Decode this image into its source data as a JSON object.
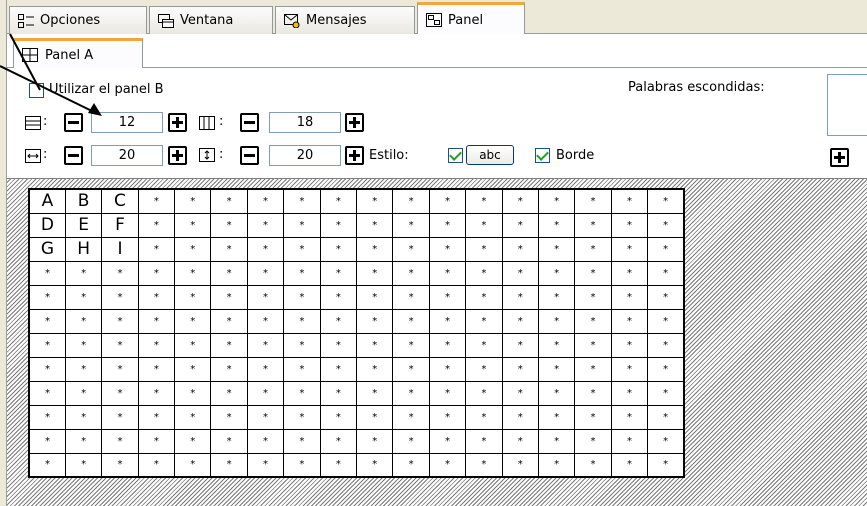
{
  "top_tabs": [
    {
      "label": "Opciones",
      "icon": "options-list-icon",
      "active": false
    },
    {
      "label": "Ventana",
      "icon": "window-icon",
      "active": false
    },
    {
      "label": "Mensajes",
      "icon": "messages-icon",
      "active": false
    },
    {
      "label": "Panel",
      "icon": "panel-icon",
      "active": true
    }
  ],
  "inner_tab": {
    "label": "Panel A",
    "icon": "grid-icon"
  },
  "controls": {
    "use_panel_b_label": "Utilizar el panel B",
    "hidden_words_label": "Palabras escondidas:",
    "rows_value": "12",
    "cols_value": "18",
    "cell_width_value": "20",
    "cell_height_value": "20",
    "colon": ":",
    "style_label": "Estilo:",
    "abc_label": "abc",
    "border_label": "Borde"
  },
  "grid": {
    "rows": [
      [
        "A",
        "B",
        "C",
        "*",
        "*",
        "*",
        "*",
        "*",
        "*",
        "*",
        "*",
        "*",
        "*",
        "*",
        "*",
        "*",
        "*",
        "*"
      ],
      [
        "D",
        "E",
        "F",
        "*",
        "*",
        "*",
        "*",
        "*",
        "*",
        "*",
        "*",
        "*",
        "*",
        "*",
        "*",
        "*",
        "*",
        "*"
      ],
      [
        "G",
        "H",
        "I",
        "*",
        "*",
        "*",
        "*",
        "*",
        "*",
        "*",
        "*",
        "*",
        "*",
        "*",
        "*",
        "*",
        "*",
        "*"
      ],
      [
        "*",
        "*",
        "*",
        "*",
        "*",
        "*",
        "*",
        "*",
        "*",
        "*",
        "*",
        "*",
        "*",
        "*",
        "*",
        "*",
        "*",
        "*"
      ],
      [
        "*",
        "*",
        "*",
        "*",
        "*",
        "*",
        "*",
        "*",
        "*",
        "*",
        "*",
        "*",
        "*",
        "*",
        "*",
        "*",
        "*",
        "*"
      ],
      [
        "*",
        "*",
        "*",
        "*",
        "*",
        "*",
        "*",
        "*",
        "*",
        "*",
        "*",
        "*",
        "*",
        "*",
        "*",
        "*",
        "*",
        "*"
      ],
      [
        "*",
        "*",
        "*",
        "*",
        "*",
        "*",
        "*",
        "*",
        "*",
        "*",
        "*",
        "*",
        "*",
        "*",
        "*",
        "*",
        "*",
        "*"
      ],
      [
        "*",
        "*",
        "*",
        "*",
        "*",
        "*",
        "*",
        "*",
        "*",
        "*",
        "*",
        "*",
        "*",
        "*",
        "*",
        "*",
        "*",
        "*"
      ],
      [
        "*",
        "*",
        "*",
        "*",
        "*",
        "*",
        "*",
        "*",
        "*",
        "*",
        "*",
        "*",
        "*",
        "*",
        "*",
        "*",
        "*",
        "*"
      ],
      [
        "*",
        "*",
        "*",
        "*",
        "*",
        "*",
        "*",
        "*",
        "*",
        "*",
        "*",
        "*",
        "*",
        "*",
        "*",
        "*",
        "*",
        "*"
      ],
      [
        "*",
        "*",
        "*",
        "*",
        "*",
        "*",
        "*",
        "*",
        "*",
        "*",
        "*",
        "*",
        "*",
        "*",
        "*",
        "*",
        "*",
        "*"
      ],
      [
        "*",
        "*",
        "*",
        "*",
        "*",
        "*",
        "*",
        "*",
        "*",
        "*",
        "*",
        "*",
        "*",
        "*",
        "*",
        "*",
        "*",
        "*"
      ]
    ]
  },
  "colors": {
    "active_tab_accent": "#f5a63a",
    "checkmark": "#21a121",
    "input_border": "#7f9db9",
    "chrome": "#ece9d8"
  }
}
